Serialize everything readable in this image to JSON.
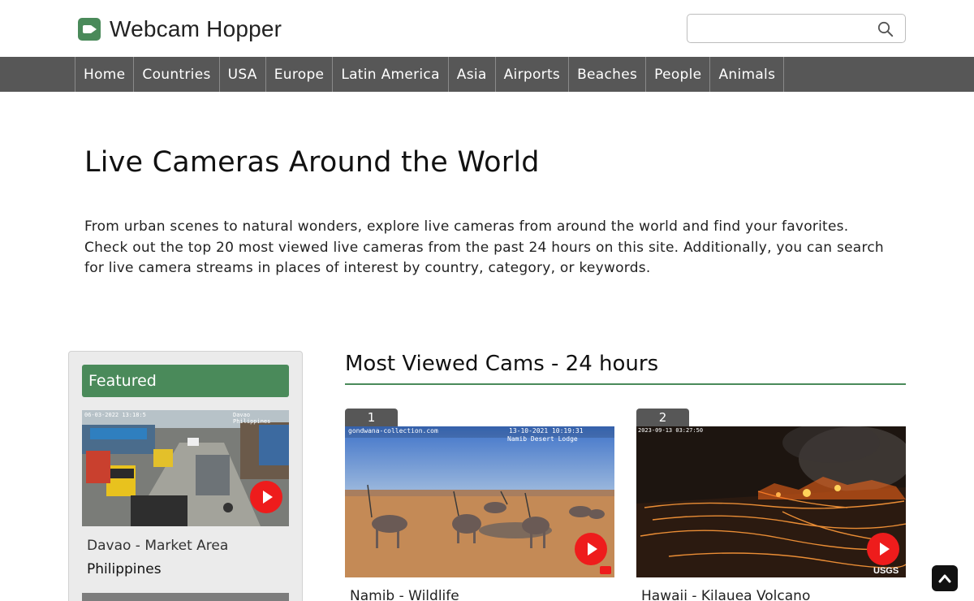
{
  "header": {
    "site_name": "Webcam Hopper",
    "search_placeholder": ""
  },
  "nav": {
    "items": [
      "Home",
      "Countries",
      "USA",
      "Europe",
      "Latin America",
      "Asia",
      "Airports",
      "Beaches",
      "People",
      "Animals"
    ]
  },
  "intro": {
    "title": "Live Cameras Around the World",
    "text": "From urban scenes to natural wonders, explore live cameras from around the world and find your favorites. Check out the top 20 most viewed live cameras from the past 24 hours on this site. Additionally, you can search for live camera streams in places of interest by country, category, or keywords."
  },
  "featured": {
    "heading": "Featured",
    "items": [
      {
        "name": "Davao - Market Area",
        "country": "Philippines",
        "overlay_date": "06-03-2022 13:18:5",
        "overlay_brand": "Davao Philippines"
      }
    ]
  },
  "most_viewed": {
    "title": "Most Viewed Cams - 24 hours",
    "cams": [
      {
        "rank": "1",
        "name": "Namib - Wildlife",
        "overlay_site": "gondwana-collection.com",
        "overlay_datetime": "13-10-2021 10:19:31",
        "overlay_location": "Namib Desert Lodge"
      },
      {
        "rank": "2",
        "name": "Hawaii - Kilauea Volcano",
        "overlay_datetime": "2023-09-13 03:27:50",
        "overlay_brand": "USGS"
      }
    ]
  },
  "colors": {
    "brand_green": "#4a8a5a",
    "nav_bg": "#575757",
    "play_red": "#ee1c1c"
  }
}
